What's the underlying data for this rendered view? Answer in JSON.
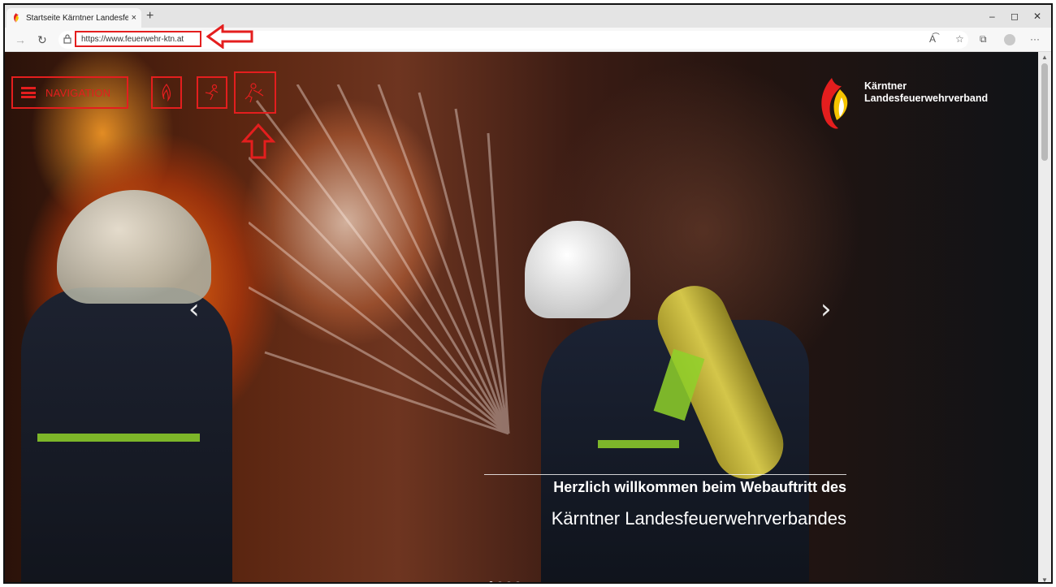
{
  "browser": {
    "tab_title": "Startseite Kärntner Landesfeuerv",
    "tab_close": "×",
    "new_tab": "+",
    "url": "https://www.feuerwehr-ktn.at",
    "window_controls": {
      "minimize": "–",
      "restore": "◻",
      "close": "✕"
    },
    "toolbar_icons": [
      "back-icon",
      "refresh-icon",
      "lock-icon",
      "read-aloud-icon",
      "favorites-icon",
      "collections-icon",
      "profile-icon",
      "more-icon"
    ],
    "more": "···"
  },
  "site": {
    "navigation_label": "NAVIGATION",
    "quick_icons": [
      "flame-icon",
      "rescue-icon",
      "hazmat-icon"
    ],
    "brand": {
      "line1": "Kärntner",
      "line2": "Landesfeuerwehrverband"
    },
    "hero": {
      "line1": "Herzlich willkommen beim Webauftritt des",
      "line2": "Kärntner Landesfeuerwehrverbandes"
    },
    "slider": {
      "prev": "‹",
      "next": "›",
      "dot_count": 4,
      "active_dot": 0
    }
  },
  "annotation_color": "#e41e1e"
}
